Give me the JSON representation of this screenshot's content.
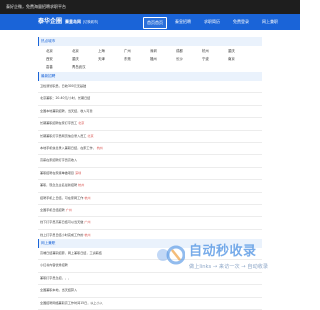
{
  "topbar": {
    "text": "泰好企微，免费海量招聘求职平台"
  },
  "brand": {
    "logo_text": "泰华企圈",
    "current_city": "秦皇岛网",
    "switch_text": "[切换城市]"
  },
  "nav": {
    "items": [
      "首页首页",
      "秦皇招聘",
      "求职简历",
      "免费登录",
      "网上兼职"
    ],
    "active_index": 0
  },
  "cities_section": {
    "title": "热点城市",
    "rows": [
      [
        "北京",
        "北京",
        "上海",
        "广州",
        "深圳",
        "成都",
        "杭州",
        "重庆"
      ],
      [
        "西安",
        "重庆",
        "天津",
        "东莞",
        "福州",
        "长沙",
        "宁波",
        "南京"
      ],
      [
        "嘉善",
        "青岛武汉"
      ]
    ]
  },
  "jobs_section": {
    "title": "最新招聘",
    "items": [
      {
        "text": "卫检测管职员，日收300元无基础",
        "tag": ""
      },
      {
        "text": "北京兼职：20-40元/小时，长期日结",
        "tag": ""
      },
      {
        "text": "全国本地兼职招聘，当天结，收入可靠",
        "tag": ""
      },
      {
        "text": "长期兼职招聘在家打字员工",
        "tag": "北京"
      },
      {
        "text": "长期兼职打字员网页信息录入员工",
        "tag": "北京"
      },
      {
        "text": "本地手机信息录入兼职日结，在家工作，",
        "tag": "杭州"
      },
      {
        "text": "高薪在家招聘打字员高收入",
        "tag": ""
      },
      {
        "text": "兼职招聘在家接单做项目",
        "tag": "深圳"
      },
      {
        "text": "兼职，现急急主名最新招聘",
        "tag": "杭州"
      },
      {
        "text": "招聘手机上日结，可在家网工作",
        "tag": "杭州"
      },
      {
        "text": "全国手机日结招聘",
        "tag": "广州"
      },
      {
        "text": "线下打字员高薪日结可以当天做",
        "tag": "广州"
      },
      {
        "text": "线上打字员日结小时完成工作的",
        "tag": "杭州"
      },
      {
        "text": "高日结工作手机兼职全职-编辑工",
        "tag": "杭州"
      },
      {
        "text": "福州兼职日结网络编辑招聘软件",
        "tag": "福州"
      },
      {
        "text": "今晚兼职日结急聘打字员手机完成",
        "tag": "福州"
      },
      {
        "text": "三大广告兼职招聘",
        "tag": "杭州"
      }
    ]
  },
  "parttime_section": {
    "title": "网上兼职",
    "items": [
      {
        "text": "高端日结兼职招募，网上兼职日结，工资薪结",
        "tag": ""
      },
      {
        "text": "小红书内容优秀招聘",
        "tag": ""
      },
      {
        "text": "兼职打字员急招，，，",
        "tag": ""
      },
      {
        "text": "全国兼职本地，当天结算入",
        "tag": ""
      },
      {
        "text": "全国招聘网络兼职高工作时间15日，以上小入",
        "tag": ""
      }
    ]
  },
  "watermark": {
    "title": "自动秒收录",
    "slogan": "做上links  →  来访一次  →  自动收录"
  },
  "colors": {
    "brand": "#1a64d8",
    "topbar": "#1e1e1e",
    "section_bg": "#eaf2fc",
    "highlight": "#d9534f",
    "watermark": "#4a90e2"
  }
}
